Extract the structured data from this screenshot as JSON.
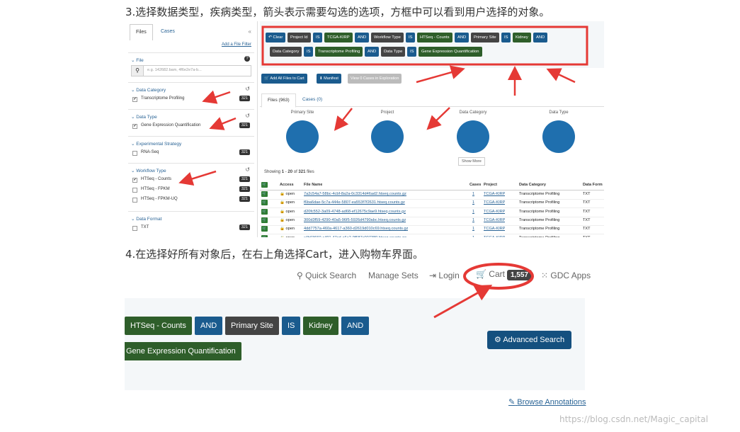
{
  "step3": "3.选择数据类型，疾病类型，箭头表示需要勾选的选项，方框中可以看到用户选择的对象。",
  "step4": "4.在选择好所有对象后，在右上角选择Cart，进入购物车界面。",
  "watermark": "https://blog.csdn.net/Magic_capital",
  "shot1": {
    "tabs": [
      "Files",
      "Cases"
    ],
    "collapse": "«",
    "add_filter": "Add a File Filter",
    "file_facet": {
      "title": "File",
      "placeholder": "e.g. 142682.bam, 4f6e2e7a-b..."
    },
    "facets": [
      {
        "title": "Data Category",
        "items": [
          {
            "label": "Transcriptome Profiling",
            "count": "321",
            "checked": true
          }
        ]
      },
      {
        "title": "Data Type",
        "items": [
          {
            "label": "Gene Expression Quantification",
            "count": "321",
            "checked": true
          }
        ]
      },
      {
        "title": "Experimental Strategy",
        "items": [
          {
            "label": "RNA-Seq",
            "count": "321",
            "checked": false
          }
        ]
      },
      {
        "title": "Workflow Type",
        "items": [
          {
            "label": "HTSeq - Counts",
            "count": "321",
            "checked": true
          },
          {
            "label": "HTSeq - FPKM",
            "count": "321",
            "checked": false
          },
          {
            "label": "HTSeq - FPKM-UQ",
            "count": "321",
            "checked": false
          }
        ]
      },
      {
        "title": "Data Format",
        "items": [
          {
            "label": "TXT",
            "count": "321",
            "checked": false
          }
        ]
      }
    ],
    "query_row1": [
      {
        "text": "↶ Clear",
        "style": "blue"
      },
      {
        "text": "Project Id",
        "style": "dark"
      },
      {
        "text": "IS",
        "style": "blue"
      },
      {
        "text": "TCGA-KIRP",
        "style": "green"
      },
      {
        "text": "AND",
        "style": "blue"
      },
      {
        "text": "Workflow Type",
        "style": "dark"
      },
      {
        "text": "IS",
        "style": "blue"
      },
      {
        "text": "HTSeq - Counts",
        "style": "green"
      },
      {
        "text": "AND",
        "style": "blue"
      },
      {
        "text": "Primary Site",
        "style": "dark"
      },
      {
        "text": "IS",
        "style": "blue"
      },
      {
        "text": "Kidney",
        "style": "green"
      },
      {
        "text": "AND",
        "style": "blue"
      }
    ],
    "query_row2": [
      {
        "text": "Data Category",
        "style": "dark"
      },
      {
        "text": "IS",
        "style": "blue"
      },
      {
        "text": "Transcriptome Profiling",
        "style": "green"
      },
      {
        "text": "AND",
        "style": "blue"
      },
      {
        "text": "Data Type",
        "style": "dark"
      },
      {
        "text": "IS",
        "style": "blue"
      },
      {
        "text": "Gene Expression Quantification",
        "style": "green"
      }
    ],
    "actions": {
      "add_all": "Add All Files to Cart",
      "manifest": "Manifest",
      "explore": "View 0 Cases in Exploration"
    },
    "file_tabs": [
      "Files (963)",
      "Cases (0)"
    ],
    "pies": [
      "Primary Site",
      "Project",
      "Data Category",
      "Data Type"
    ],
    "show_more": "Show More",
    "showing": {
      "prefix": "Showing ",
      "from": "1",
      "dash": " - ",
      "to": "20",
      "of": " of ",
      "total": "321",
      "suffix": " files"
    },
    "columns": [
      "Access",
      "File Name",
      "Cases",
      "Project",
      "Data Category",
      "Data Form"
    ],
    "rows": [
      {
        "access": "open",
        "file": "7a2c54a7-58bc-4cbf-8a2a-0c3314d46ad2.htseq.counts.gz",
        "cases": "1",
        "project": "TCGA-KIRP",
        "category": "Transcriptome Profiling",
        "format": "TXT"
      },
      {
        "access": "open",
        "file": "f6ba6dae-5c7a-444e-5807-ea553f7f2631.htseq.counts.gz",
        "cases": "1",
        "project": "TCGA-KIRP",
        "category": "Transcriptome Profiling",
        "format": "TXT"
      },
      {
        "access": "open",
        "file": "d20fc552-3a09-4748-ad68-ef12675c9ae9.htseq.counts.gz",
        "cases": "1",
        "project": "TCGA-KIRP",
        "category": "Transcriptome Profiling",
        "format": "TXT"
      },
      {
        "access": "open",
        "file": "300d3f59-4290-40a5-96f5-5926d4790abc.htseq.counts.gz",
        "cases": "1",
        "project": "TCGA-KIRP",
        "category": "Transcriptome Profiling",
        "format": "TXT"
      },
      {
        "access": "open",
        "file": "4dd7757a-460a-4617-a360-d2619d010c69.htseq.counts.gz",
        "cases": "1",
        "project": "TCGA-KIRP",
        "category": "Transcriptome Profiling",
        "format": "TXT"
      },
      {
        "access": "open",
        "file": "c4b03660-c491-47cd-a6e2-9f587c007389.htseq.counts.gz",
        "cases": "1",
        "project": "TCGA-KIRP",
        "category": "Transcriptome Profiling",
        "format": "TXT"
      }
    ]
  },
  "shot2": {
    "nav": {
      "quick_search": "Quick Search",
      "manage_sets": "Manage Sets",
      "login": "Login",
      "cart": "Cart",
      "cart_count": "1,557",
      "gdc_apps": "GDC Apps"
    },
    "pills_row1": [
      {
        "text": "HTSeq - Counts",
        "style": "green"
      },
      {
        "text": "AND",
        "style": "blue"
      },
      {
        "text": "Primary Site",
        "style": "dark"
      },
      {
        "text": "IS",
        "style": "blue"
      },
      {
        "text": "Kidney",
        "style": "green"
      },
      {
        "text": "AND",
        "style": "blue"
      }
    ],
    "pills_row2": [
      {
        "text": "Gene Expression Quantification",
        "style": "green"
      }
    ],
    "advanced_search": "Advanced Search",
    "browse_annotations": "Browse Annotations"
  },
  "colors": {
    "annotation_red": "#e53935",
    "pill_blue": "#1a5b8e",
    "pill_green": "#2e5e2a",
    "pill_dark": "#444444"
  }
}
